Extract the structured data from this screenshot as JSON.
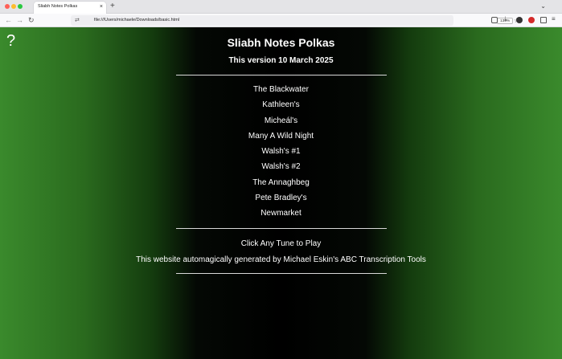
{
  "browser": {
    "tab_title": "Sliabh Notes Polkas",
    "tab_close": "×",
    "new_tab": "+",
    "url": "file:///Users/michaele/Downloads/basic.html",
    "zoom": "133%"
  },
  "page": {
    "help": "?",
    "title": "Sliabh Notes Polkas",
    "subtitle": "This version 10 March 2025",
    "tunes": [
      "The Blackwater",
      "Kathleen's",
      "Micheál's",
      "Many A Wild Night",
      "Walsh's #1",
      "Walsh's #2",
      "The Annaghbeg",
      "Pete Bradley's",
      "Newmarket"
    ],
    "instruction": "Click Any Tune to Play",
    "credit": "This website automagically generated by Michael Eskin's ABC Transcription Tools"
  },
  "colors": {
    "background_edge": "#3a8a2c",
    "background_center": "#000000",
    "text": "#ffffff"
  }
}
